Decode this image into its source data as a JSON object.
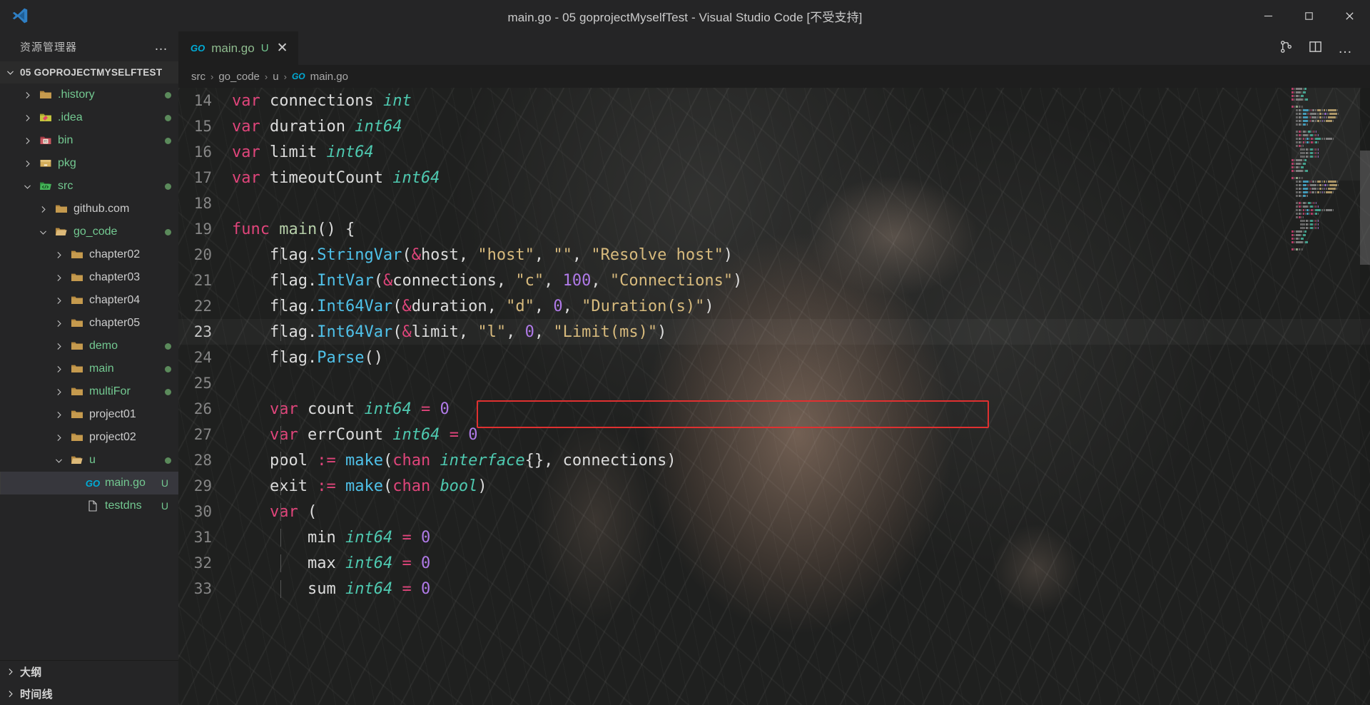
{
  "window": {
    "title": "main.go - 05 goprojectMyselfTest - Visual Studio Code [不受支持]",
    "logo_name": "vscode-logo",
    "controls": {
      "minimize": "−",
      "maximize": "▢",
      "close": "✕"
    }
  },
  "sidebar": {
    "header": {
      "title": "资源管理器",
      "more_actions": "…"
    },
    "root": {
      "label": "05 GOPROJECTMYSELFTEST",
      "expanded": true
    },
    "items": [
      {
        "label": ".history",
        "icon": "folder-history-icon",
        "indent": 1,
        "expanded": false,
        "color": "green",
        "dot": true,
        "type": "folder"
      },
      {
        "label": ".idea",
        "icon": "folder-idea-icon",
        "indent": 1,
        "expanded": false,
        "color": "green",
        "dot": true,
        "type": "folder"
      },
      {
        "label": "bin",
        "icon": "folder-bin-icon",
        "indent": 1,
        "expanded": false,
        "color": "green",
        "dot": true,
        "type": "folder"
      },
      {
        "label": "pkg",
        "icon": "folder-pkg-icon",
        "indent": 1,
        "expanded": false,
        "color": "green",
        "dot": false,
        "type": "folder"
      },
      {
        "label": "src",
        "icon": "folder-src-icon",
        "indent": 1,
        "expanded": true,
        "color": "green",
        "dot": true,
        "type": "folder"
      },
      {
        "label": "github.com",
        "icon": "folder-icon",
        "indent": 2,
        "expanded": false,
        "color": "gray",
        "dot": false,
        "type": "folder"
      },
      {
        "label": "go_code",
        "icon": "folder-open-icon",
        "indent": 2,
        "expanded": true,
        "color": "green",
        "dot": true,
        "type": "folder"
      },
      {
        "label": "chapter02",
        "icon": "folder-icon",
        "indent": 3,
        "expanded": false,
        "color": "gray",
        "dot": false,
        "type": "folder"
      },
      {
        "label": "chapter03",
        "icon": "folder-icon",
        "indent": 3,
        "expanded": false,
        "color": "gray",
        "dot": false,
        "type": "folder"
      },
      {
        "label": "chapter04",
        "icon": "folder-icon",
        "indent": 3,
        "expanded": false,
        "color": "gray",
        "dot": false,
        "type": "folder"
      },
      {
        "label": "chapter05",
        "icon": "folder-icon",
        "indent": 3,
        "expanded": false,
        "color": "gray",
        "dot": false,
        "type": "folder"
      },
      {
        "label": "demo",
        "icon": "folder-icon",
        "indent": 3,
        "expanded": false,
        "color": "green",
        "dot": true,
        "type": "folder"
      },
      {
        "label": "main",
        "icon": "folder-icon",
        "indent": 3,
        "expanded": false,
        "color": "green",
        "dot": true,
        "type": "folder"
      },
      {
        "label": "multiFor",
        "icon": "folder-icon",
        "indent": 3,
        "expanded": false,
        "color": "green",
        "dot": true,
        "type": "folder"
      },
      {
        "label": "project01",
        "icon": "folder-icon",
        "indent": 3,
        "expanded": false,
        "color": "gray",
        "dot": false,
        "type": "folder"
      },
      {
        "label": "project02",
        "icon": "folder-icon",
        "indent": 3,
        "expanded": false,
        "color": "gray",
        "dot": false,
        "type": "folder"
      },
      {
        "label": "u",
        "icon": "folder-open-icon",
        "indent": 3,
        "expanded": true,
        "color": "green",
        "dot": true,
        "type": "folder"
      },
      {
        "label": "main.go",
        "icon": "go-file-icon",
        "indent": 4,
        "color": "green",
        "status": "U",
        "selected": true,
        "type": "file"
      },
      {
        "label": "testdns",
        "icon": "file-icon",
        "indent": 4,
        "color": "green",
        "status": "U",
        "selected": false,
        "type": "file"
      }
    ],
    "bottom_sections": [
      {
        "label": "大纲",
        "expanded": false
      },
      {
        "label": "时间线",
        "expanded": false
      }
    ]
  },
  "editor": {
    "tab": {
      "icon": "go-file-icon",
      "name": "main.go",
      "state": "U",
      "close": "✕"
    },
    "actions": [
      {
        "name": "split-editor-vertical-icon"
      },
      {
        "name": "source-control-compare-icon"
      },
      {
        "name": "more-actions-icon",
        "label": "…"
      }
    ],
    "breadcrumb": [
      {
        "label": "src"
      },
      {
        "label": "go_code"
      },
      {
        "label": "u"
      },
      {
        "label": "main.go",
        "icon": "go-file-icon"
      }
    ],
    "separator": "›",
    "current_line": 23,
    "lines": [
      {
        "n": 14,
        "indent": 0,
        "tokens": [
          {
            "t": "var",
            "c": "k"
          },
          {
            "t": " ",
            "c": "op"
          },
          {
            "t": "connections",
            "c": "id"
          },
          {
            "t": " ",
            "c": "op"
          },
          {
            "t": "int",
            "c": "typ"
          }
        ]
      },
      {
        "n": 15,
        "indent": 0,
        "tokens": [
          {
            "t": "var",
            "c": "k"
          },
          {
            "t": " ",
            "c": "op"
          },
          {
            "t": "duration",
            "c": "id"
          },
          {
            "t": " ",
            "c": "op"
          },
          {
            "t": "int64",
            "c": "typ"
          }
        ]
      },
      {
        "n": 16,
        "indent": 0,
        "tokens": [
          {
            "t": "var",
            "c": "k"
          },
          {
            "t": " ",
            "c": "op"
          },
          {
            "t": "limit",
            "c": "id"
          },
          {
            "t": " ",
            "c": "op"
          },
          {
            "t": "int64",
            "c": "typ"
          }
        ]
      },
      {
        "n": 17,
        "indent": 0,
        "tokens": [
          {
            "t": "var",
            "c": "k"
          },
          {
            "t": " ",
            "c": "op"
          },
          {
            "t": "timeoutCount",
            "c": "id"
          },
          {
            "t": " ",
            "c": "op"
          },
          {
            "t": "int64",
            "c": "typ"
          }
        ]
      },
      {
        "n": 18,
        "indent": 0,
        "tokens": []
      },
      {
        "n": 19,
        "indent": 0,
        "tokens": [
          {
            "t": "func",
            "c": "k"
          },
          {
            "t": " ",
            "c": "op"
          },
          {
            "t": "main",
            "c": "fn"
          },
          {
            "t": "()",
            "c": "op"
          },
          {
            "t": " ",
            "c": "op"
          },
          {
            "t": "{",
            "c": "op"
          }
        ]
      },
      {
        "n": 20,
        "indent": 1,
        "tokens": [
          {
            "t": "    ",
            "c": "op"
          },
          {
            "t": "flag",
            "c": "id"
          },
          {
            "t": ".",
            "c": "op"
          },
          {
            "t": "StringVar",
            "c": "mem"
          },
          {
            "t": "(",
            "c": "op"
          },
          {
            "t": "&",
            "c": "amp"
          },
          {
            "t": "host",
            "c": "id"
          },
          {
            "t": ", ",
            "c": "op"
          },
          {
            "t": "\"host\"",
            "c": "str"
          },
          {
            "t": ", ",
            "c": "op"
          },
          {
            "t": "\"\"",
            "c": "str"
          },
          {
            "t": ", ",
            "c": "op"
          },
          {
            "t": "\"Resolve host\"",
            "c": "str"
          },
          {
            "t": ")",
            "c": "op"
          }
        ]
      },
      {
        "n": 21,
        "indent": 1,
        "tokens": [
          {
            "t": "    ",
            "c": "op"
          },
          {
            "t": "flag",
            "c": "id"
          },
          {
            "t": ".",
            "c": "op"
          },
          {
            "t": "IntVar",
            "c": "mem"
          },
          {
            "t": "(",
            "c": "op"
          },
          {
            "t": "&",
            "c": "amp"
          },
          {
            "t": "connections",
            "c": "id"
          },
          {
            "t": ", ",
            "c": "op"
          },
          {
            "t": "\"c\"",
            "c": "str"
          },
          {
            "t": ", ",
            "c": "op"
          },
          {
            "t": "100",
            "c": "num"
          },
          {
            "t": ", ",
            "c": "op"
          },
          {
            "t": "\"Connections\"",
            "c": "str"
          },
          {
            "t": ")",
            "c": "op"
          }
        ]
      },
      {
        "n": 22,
        "indent": 1,
        "tokens": [
          {
            "t": "    ",
            "c": "op"
          },
          {
            "t": "flag",
            "c": "id"
          },
          {
            "t": ".",
            "c": "op"
          },
          {
            "t": "Int64Var",
            "c": "mem"
          },
          {
            "t": "(",
            "c": "op"
          },
          {
            "t": "&",
            "c": "amp"
          },
          {
            "t": "duration",
            "c": "id"
          },
          {
            "t": ", ",
            "c": "op"
          },
          {
            "t": "\"d\"",
            "c": "str"
          },
          {
            "t": ", ",
            "c": "op"
          },
          {
            "t": "0",
            "c": "num"
          },
          {
            "t": ", ",
            "c": "op"
          },
          {
            "t": "\"Duration(s)\"",
            "c": "str"
          },
          {
            "t": ")",
            "c": "op"
          }
        ]
      },
      {
        "n": 23,
        "indent": 1,
        "tokens": [
          {
            "t": "    ",
            "c": "op"
          },
          {
            "t": "flag",
            "c": "id"
          },
          {
            "t": ".",
            "c": "op"
          },
          {
            "t": "Int64Var",
            "c": "mem"
          },
          {
            "t": "(",
            "c": "op"
          },
          {
            "t": "&",
            "c": "amp"
          },
          {
            "t": "limit",
            "c": "id"
          },
          {
            "t": ", ",
            "c": "op"
          },
          {
            "t": "\"l\"",
            "c": "str"
          },
          {
            "t": ", ",
            "c": "op"
          },
          {
            "t": "0",
            "c": "num"
          },
          {
            "t": ", ",
            "c": "op"
          },
          {
            "t": "\"Limit(ms)\"",
            "c": "str"
          },
          {
            "t": ")",
            "c": "op"
          }
        ]
      },
      {
        "n": 24,
        "indent": 1,
        "tokens": [
          {
            "t": "    ",
            "c": "op"
          },
          {
            "t": "flag",
            "c": "id"
          },
          {
            "t": ".",
            "c": "op"
          },
          {
            "t": "Parse",
            "c": "mem"
          },
          {
            "t": "()",
            "c": "op"
          }
        ]
      },
      {
        "n": 25,
        "indent": 1,
        "tokens": []
      },
      {
        "n": 26,
        "indent": 1,
        "tokens": [
          {
            "t": "    ",
            "c": "op"
          },
          {
            "t": "var",
            "c": "k"
          },
          {
            "t": " ",
            "c": "op"
          },
          {
            "t": "count",
            "c": "id"
          },
          {
            "t": " ",
            "c": "op"
          },
          {
            "t": "int64",
            "c": "typ"
          },
          {
            "t": " ",
            "c": "op"
          },
          {
            "t": "=",
            "c": "amp"
          },
          {
            "t": " ",
            "c": "op"
          },
          {
            "t": "0",
            "c": "num"
          }
        ]
      },
      {
        "n": 27,
        "indent": 1,
        "tokens": [
          {
            "t": "    ",
            "c": "op"
          },
          {
            "t": "var",
            "c": "k"
          },
          {
            "t": " ",
            "c": "op"
          },
          {
            "t": "errCount",
            "c": "id"
          },
          {
            "t": " ",
            "c": "op"
          },
          {
            "t": "int64",
            "c": "typ"
          },
          {
            "t": " ",
            "c": "op"
          },
          {
            "t": "=",
            "c": "amp"
          },
          {
            "t": " ",
            "c": "op"
          },
          {
            "t": "0",
            "c": "num"
          }
        ]
      },
      {
        "n": 28,
        "indent": 1,
        "tokens": [
          {
            "t": "    ",
            "c": "op"
          },
          {
            "t": "pool",
            "c": "id"
          },
          {
            "t": " ",
            "c": "op"
          },
          {
            "t": ":=",
            "c": "amp"
          },
          {
            "t": " ",
            "c": "op"
          },
          {
            "t": "make",
            "c": "mem"
          },
          {
            "t": "(",
            "c": "op"
          },
          {
            "t": "chan",
            "c": "k"
          },
          {
            "t": " ",
            "c": "op"
          },
          {
            "t": "interface",
            "c": "typ"
          },
          {
            "t": "{}",
            "c": "op"
          },
          {
            "t": ", ",
            "c": "op"
          },
          {
            "t": "connections",
            "c": "id"
          },
          {
            "t": ")",
            "c": "op"
          }
        ]
      },
      {
        "n": 29,
        "indent": 1,
        "tokens": [
          {
            "t": "    ",
            "c": "op"
          },
          {
            "t": "exit",
            "c": "id"
          },
          {
            "t": " ",
            "c": "op"
          },
          {
            "t": ":=",
            "c": "amp"
          },
          {
            "t": " ",
            "c": "op"
          },
          {
            "t": "make",
            "c": "mem"
          },
          {
            "t": "(",
            "c": "op"
          },
          {
            "t": "chan",
            "c": "k"
          },
          {
            "t": " ",
            "c": "op"
          },
          {
            "t": "bool",
            "c": "typ"
          },
          {
            "t": ")",
            "c": "op"
          }
        ]
      },
      {
        "n": 30,
        "indent": 1,
        "tokens": [
          {
            "t": "    ",
            "c": "op"
          },
          {
            "t": "var",
            "c": "k"
          },
          {
            "t": " ",
            "c": "op"
          },
          {
            "t": "(",
            "c": "op"
          }
        ]
      },
      {
        "n": 31,
        "indent": 2,
        "tokens": [
          {
            "t": "        ",
            "c": "op"
          },
          {
            "t": "min",
            "c": "id"
          },
          {
            "t": " ",
            "c": "op"
          },
          {
            "t": "int64",
            "c": "typ"
          },
          {
            "t": " ",
            "c": "op"
          },
          {
            "t": "=",
            "c": "amp"
          },
          {
            "t": " ",
            "c": "op"
          },
          {
            "t": "0",
            "c": "num"
          }
        ]
      },
      {
        "n": 32,
        "indent": 2,
        "tokens": [
          {
            "t": "        ",
            "c": "op"
          },
          {
            "t": "max",
            "c": "id"
          },
          {
            "t": " ",
            "c": "op"
          },
          {
            "t": "int64",
            "c": "typ"
          },
          {
            "t": " ",
            "c": "op"
          },
          {
            "t": "=",
            "c": "amp"
          },
          {
            "t": " ",
            "c": "op"
          },
          {
            "t": "0",
            "c": "num"
          }
        ]
      },
      {
        "n": 33,
        "indent": 2,
        "tokens": [
          {
            "t": "        ",
            "c": "op"
          },
          {
            "t": "sum",
            "c": "id"
          },
          {
            "t": " ",
            "c": "op"
          },
          {
            "t": "int64",
            "c": "typ"
          },
          {
            "t": " ",
            "c": "op"
          },
          {
            "t": "=",
            "c": "amp"
          },
          {
            "t": " ",
            "c": "op"
          },
          {
            "t": "0",
            "c": "num"
          }
        ]
      }
    ],
    "annotation": {
      "name": "red-highlight-box",
      "target_line": 23,
      "color": "#e03030"
    }
  },
  "colors": {
    "accent": "#007acc",
    "go_blue": "#00acd7",
    "git_untracked": "#73c991",
    "editor_bg": "#1e1e1e",
    "sidebar_bg": "#252526"
  }
}
